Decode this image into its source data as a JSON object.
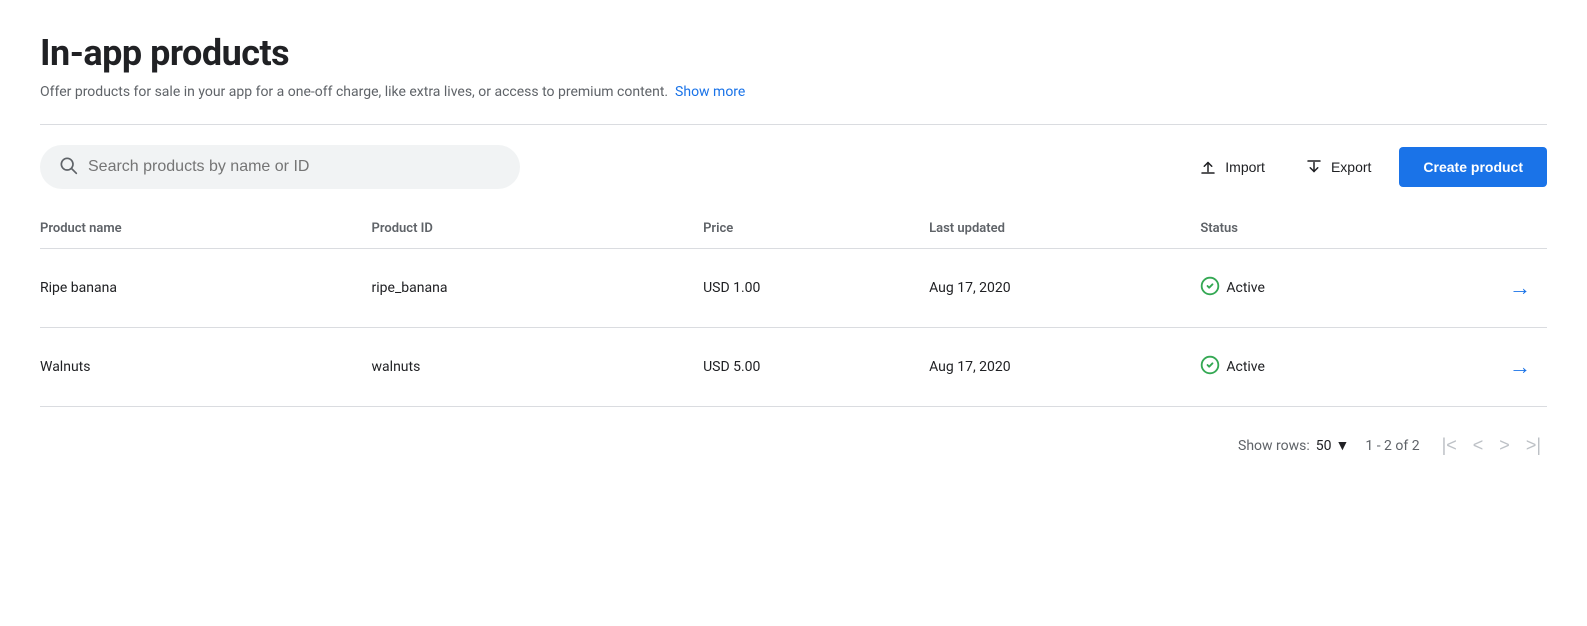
{
  "header": {
    "title": "In-app products",
    "subtitle": "Offer products for sale in your app for a one-off charge, like extra lives, or access to premium content.",
    "show_more_label": "Show more"
  },
  "toolbar": {
    "search_placeholder": "Search products by name or ID",
    "import_label": "Import",
    "export_label": "Export",
    "create_label": "Create product"
  },
  "table": {
    "columns": [
      {
        "key": "name",
        "label": "Product name"
      },
      {
        "key": "id",
        "label": "Product ID"
      },
      {
        "key": "price",
        "label": "Price"
      },
      {
        "key": "updated",
        "label": "Last updated"
      },
      {
        "key": "status",
        "label": "Status"
      }
    ],
    "rows": [
      {
        "name": "Ripe banana",
        "id": "ripe_banana",
        "price": "USD 1.00",
        "updated": "Aug 17, 2020",
        "status": "Active"
      },
      {
        "name": "Walnuts",
        "id": "walnuts",
        "price": "USD 5.00",
        "updated": "Aug 17, 2020",
        "status": "Active"
      }
    ]
  },
  "pagination": {
    "show_rows_label": "Show rows:",
    "rows_per_page": "50",
    "page_info": "1 - 2 of 2"
  },
  "colors": {
    "primary": "#1a73e8",
    "active_status": "#34a853"
  }
}
